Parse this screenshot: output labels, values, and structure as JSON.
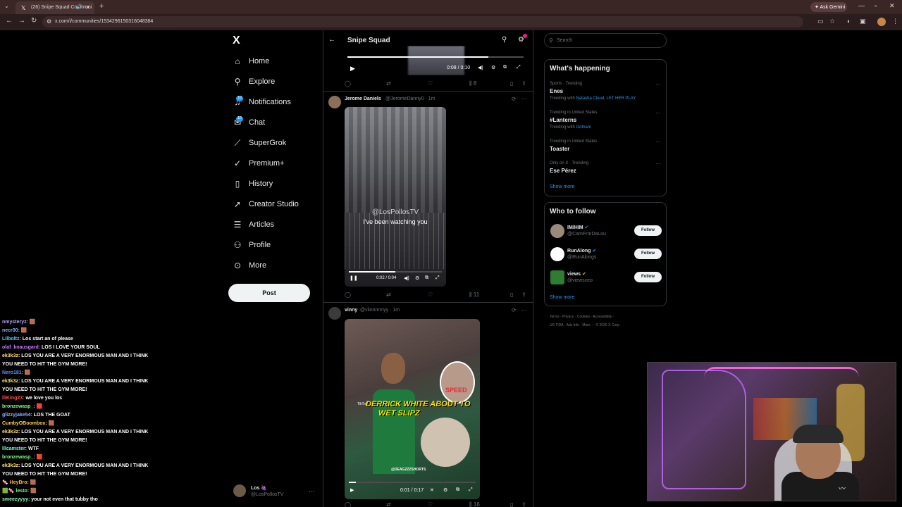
{
  "browser": {
    "tab_title": "(26) Snipe Squad Communi",
    "url": "x.com/i/communities/1534296150316048384",
    "ask_gemini": "Ask Gemini"
  },
  "nav": {
    "logo": "X",
    "items": [
      {
        "label": "Home",
        "icon": "home-icon"
      },
      {
        "label": "Explore",
        "icon": "search-icon"
      },
      {
        "label": "Notifications",
        "icon": "bell-icon",
        "badge": "10"
      },
      {
        "label": "Chat",
        "icon": "chat-icon",
        "badge": "10"
      },
      {
        "label": "SuperGrok",
        "icon": "grok-icon"
      },
      {
        "label": "Premium+",
        "icon": "premium-icon"
      },
      {
        "label": "History",
        "icon": "bookmark-icon"
      },
      {
        "label": "Creator Studio",
        "icon": "rocket-icon"
      },
      {
        "label": "Articles",
        "icon": "article-icon"
      },
      {
        "label": "Profile",
        "icon": "person-icon"
      },
      {
        "label": "More",
        "icon": "more-icon"
      }
    ],
    "post_label": "Post",
    "account": {
      "name": "Los 🍇",
      "handle": "@LosPollosTV"
    }
  },
  "community": {
    "title": "Snipe Squad",
    "top_video": {
      "time": "0:08 / 0:10",
      "progress": 0.8,
      "views": "8"
    },
    "posts": [
      {
        "name": "Jerome Daniels",
        "handle": "@JeromeDanny0 · 1m",
        "overlay_watermark": "@LosPollosTV",
        "overlay_text": "I've been watching you",
        "time": "0:02 / 0:04",
        "views": "11"
      },
      {
        "name": "vinny",
        "handle": "@viinnnnnyy · 1m",
        "title_line1": "DERRICK WHITE ABOUT TO",
        "title_line2": "WET SLIPZ",
        "badge_text": "SPEED",
        "tiktok": "TikTok",
        "watermark": "@DEAGZZZSHORTS",
        "time": "0:01 / 0:17",
        "views": "16"
      }
    ]
  },
  "sidebar": {
    "search_placeholder": "Search",
    "happening_title": "What's happening",
    "trends": [
      {
        "meta": "Sports · Trending",
        "name": "Enes",
        "sub_prefix": "Trending with ",
        "sub_link": "Natasha Cloud, LET HER PLAY"
      },
      {
        "meta": "Trending in United States",
        "name": "#Lanterns",
        "sub_prefix": "Trending with ",
        "sub_link": "Gotham"
      },
      {
        "meta": "Trending in United States",
        "name": "Toaster",
        "sub_prefix": "",
        "sub_link": ""
      },
      {
        "meta": "Only on X · Trending",
        "name": "Ese Pérez",
        "sub_prefix": "",
        "sub_link": ""
      }
    ],
    "show_more": "Show more",
    "who_title": "Who to follow",
    "who": [
      {
        "name": "IM/HIM",
        "handle": "@CamFrmDaLou",
        "follow": "Follow"
      },
      {
        "name": "RunAlong",
        "handle": "@RunAlongs",
        "follow": "Follow"
      },
      {
        "name": "views",
        "handle": "@viewsceo",
        "follow": "Follow"
      }
    ],
    "footer1": "Terms · Privacy · Cookies · Accessibility ·",
    "footer2": "US TIDA · Ads Info · More ··· © 2026 X Corp."
  },
  "chat": [
    {
      "user": "nmysteryz:",
      "color": "#b9a3ff",
      "msg": "🟫"
    },
    {
      "user": "necr00:",
      "color": "#7fb2ff",
      "msg": "🟫"
    },
    {
      "user": "Lilboltz:",
      "color": "#4fd1ff",
      "msg": "Los start an of please"
    },
    {
      "user": "olaf_knausgard:",
      "color": "#c77dff",
      "msg": "LOS I LOVE YOUR SOUL"
    },
    {
      "user": "ek3k3z:",
      "color": "#ffe066",
      "msg": "LOS YOU ARE A VERY ENORMOUS MAN AND I THINK"
    },
    {
      "user": "",
      "color": "#fff",
      "msg": "YOU NEED TO HIT THE GYM MORE!"
    },
    {
      "user": "Nero181:",
      "color": "#5a8cff",
      "msg": "🟫"
    },
    {
      "user": "ek3k3z:",
      "color": "#ffe066",
      "msg": "LOS YOU ARE A VERY ENORMOUS MAN AND I THINK"
    },
    {
      "user": "",
      "color": "#fff",
      "msg": "YOU NEED TO HIT THE GYM MORE!"
    },
    {
      "user": "lliKing23:",
      "color": "#ff4d4d",
      "msg": "we love you los"
    },
    {
      "user": "bronzewasp_:",
      "color": "#7dff7d",
      "msg": "🟥"
    },
    {
      "user": "glizzyjake54:",
      "color": "#8ab4ff",
      "msg": "LOS THE GOAT"
    },
    {
      "user": "CumbyOBoombox:",
      "color": "#ffd24a",
      "msg": "🟫"
    },
    {
      "user": "ek3k3z:",
      "color": "#ffe066",
      "msg": "LOS YOU ARE A VERY ENORMOUS MAN AND I THINK"
    },
    {
      "user": "",
      "color": "#fff",
      "msg": "YOU NEED TO HIT THE GYM MORE!"
    },
    {
      "user": "lllcamster:",
      "color": "#66ffcc",
      "msg": "WTF"
    },
    {
      "user": "bronzewasp_:",
      "color": "#7dff7d",
      "msg": "🟥"
    },
    {
      "user": "ek3k3z:",
      "color": "#ffe066",
      "msg": "LOS YOU ARE A VERY ENORMOUS MAN AND I THINK"
    },
    {
      "user": "",
      "color": "#fff",
      "msg": "YOU NEED TO HIT THE GYM MORE!"
    },
    {
      "user": "🍬 HeyBro:",
      "color": "#ffb347",
      "msg": "🟫"
    },
    {
      "user": "🟩🍬 lesto:",
      "color": "#7dff7d",
      "msg": "🟫"
    },
    {
      "user": "smeezyyyy:",
      "color": "#8affc1",
      "msg": "your not even that tubby tho"
    }
  ],
  "colors": {
    "accent": "#1d9bf0",
    "bg": "#000000",
    "border": "#2f3336"
  }
}
